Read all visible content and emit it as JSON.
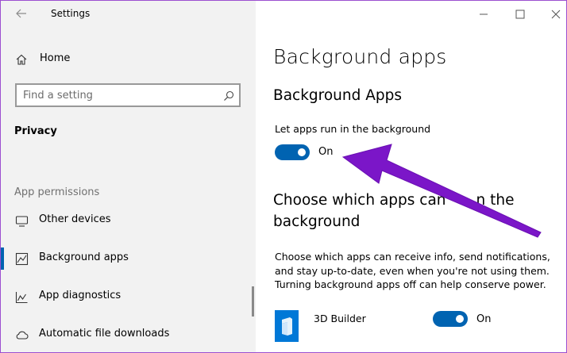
{
  "window": {
    "title": "Settings"
  },
  "sidebar": {
    "home_label": "Home",
    "search_placeholder": "Find a setting",
    "section": "Privacy",
    "group_label": "App permissions",
    "items": [
      {
        "label": "Other devices",
        "icon": "other-devices-icon"
      },
      {
        "label": "Background apps",
        "icon": "background-apps-icon",
        "selected": true
      },
      {
        "label": "App diagnostics",
        "icon": "app-diagnostics-icon"
      },
      {
        "label": "Automatic file downloads",
        "icon": "cloud-icon"
      }
    ]
  },
  "main": {
    "page_title": "Background apps",
    "section_title": "Background Apps",
    "setting_label": "Let apps run in the background",
    "toggle_state": "On",
    "choose_title": "Choose which apps can run in the background",
    "choose_visible_line1_a": "Choose which apps can",
    "choose_visible_line1_b": "n the",
    "choose_line2": "background",
    "description": "Choose which apps can receive info, send notifications, and stay up-to-date, even when you're not using them. Turning background apps off can help conserve power.",
    "apps": [
      {
        "name": "3D Builder",
        "state": "On"
      }
    ]
  },
  "colors": {
    "accent": "#0063b1",
    "annotation_arrow": "#7b16c8",
    "sidebar_bg": "#f2f2f2"
  }
}
